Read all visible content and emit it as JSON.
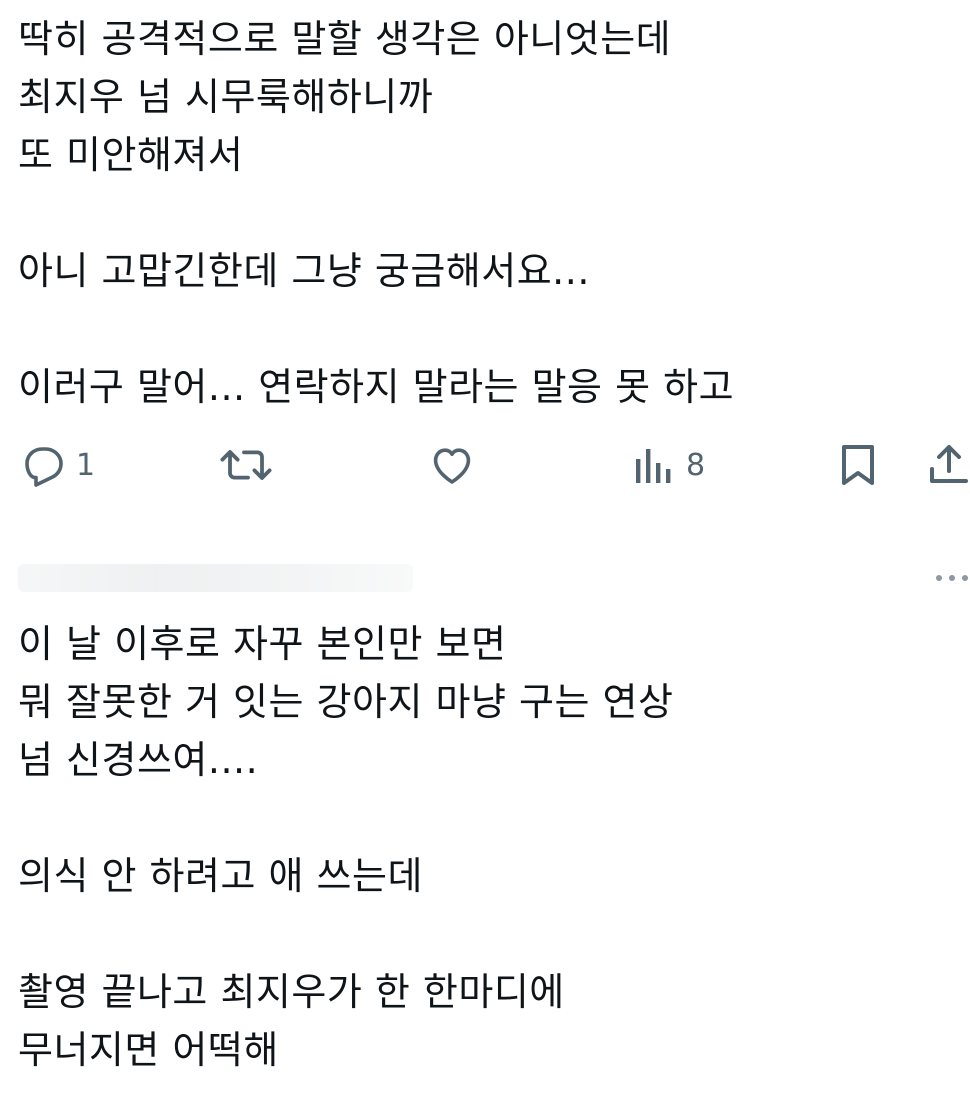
{
  "tweet1": {
    "lines": [
      "딱히 공격적으로 말할 생각은 아니엇는데",
      "최지우 넘 시무룩해하니까",
      "또 미안해져서",
      "",
      "아니 고맙긴한데 그냥 궁금해서요...",
      "",
      "이러구 말어... 연락하지 말라는 말응 못 하고"
    ]
  },
  "actions": {
    "reply": {
      "icon": "reply-icon",
      "count": "1"
    },
    "retweet": {
      "icon": "retweet-icon",
      "count": ""
    },
    "like": {
      "icon": "heart-icon",
      "count": ""
    },
    "views": {
      "icon": "views-icon",
      "count": "8"
    },
    "bookmark": {
      "icon": "bookmark-icon"
    },
    "share": {
      "icon": "share-icon"
    }
  },
  "tweet2": {
    "more_icon": "more-horizontal-icon",
    "lines": [
      "이 날 이후로 자꾸 본인만 보면",
      "뭐 잘못한 거 잇는 강아지 마냥 구는 연상",
      "넘 신경쓰여....",
      "",
      "의식 안 하려고 애 쓰는데",
      "",
      "촬영 끝나고 최지우가 한 한마디에",
      "무너지면 어떡해"
    ]
  },
  "colors": {
    "text": "#0f1419",
    "icon": "#536471"
  }
}
